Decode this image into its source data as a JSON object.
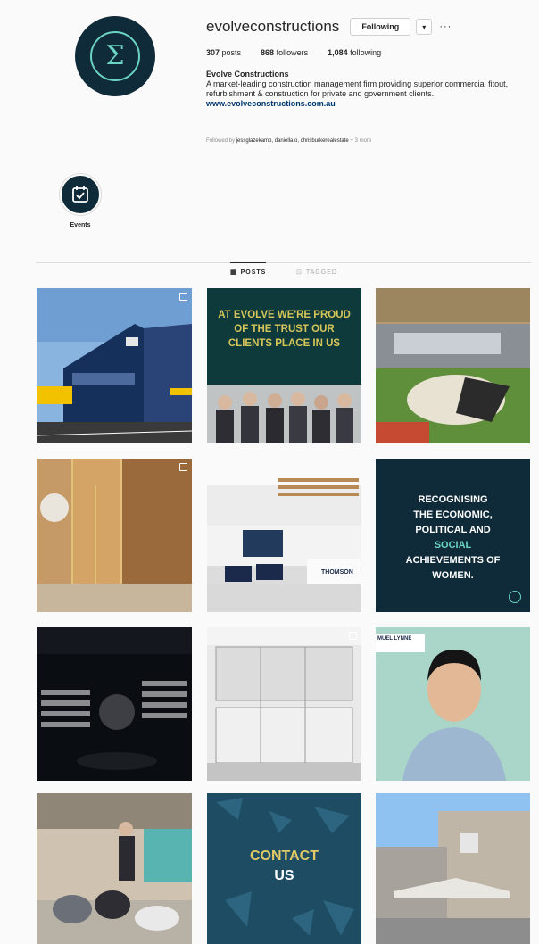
{
  "profile": {
    "username": "evolveconstructions",
    "follow_label": "Following",
    "more_label": "···",
    "posts": "307",
    "posts_label": " posts",
    "followers": "868",
    "followers_label": " followers",
    "following": "1,084",
    "following_label": " following",
    "display_name": "Evolve Constructions",
    "bio": "A market-leading construction management firm providing superior commercial fitout, refurbishment & construction for private and government clients.",
    "website": "www.evolveconstructions.com.au",
    "followed_prefix": "Followed by ",
    "followed_names": "jessglazekamp, daniella.o, chrisburkerealestate",
    "followed_suffix": " + 3 more"
  },
  "highlights": [
    {
      "label": "Events",
      "icon": "calendar-check-icon"
    }
  ],
  "tabs": [
    {
      "label": "POSTS",
      "icon": "grid-icon",
      "active": true
    },
    {
      "label": "TAGGED",
      "icon": "tag-icon",
      "active": false
    }
  ],
  "posts": [
    {
      "id": "post-1",
      "caption": "",
      "multi": true
    },
    {
      "id": "post-2",
      "caption_lines": [
        "AT EVOLVE WE'RE PROUD",
        "OF THE TRUST OUR",
        "CLIENTS PLACE IN US"
      ],
      "multi": false
    },
    {
      "id": "post-3",
      "caption": "",
      "multi": false
    },
    {
      "id": "post-4",
      "caption": "",
      "multi": true
    },
    {
      "id": "post-5",
      "sign": "THOMSON",
      "multi": false
    },
    {
      "id": "post-6",
      "caption_lines": [
        "RECOGNISING",
        "THE ECONOMIC,",
        "POLITICAL AND",
        "SOCIAL",
        "ACHIEVEMENTS OF",
        "WOMEN."
      ],
      "multi": false
    },
    {
      "id": "post-7",
      "caption": "",
      "multi": false
    },
    {
      "id": "post-8",
      "caption": "",
      "multi": true
    },
    {
      "id": "post-9",
      "name_tag": "MUEL LYNNE",
      "multi": false
    },
    {
      "id": "post-10",
      "caption": "",
      "multi": false
    },
    {
      "id": "post-11",
      "caption_lines": [
        "CONTACT",
        "US"
      ],
      "multi": false
    },
    {
      "id": "post-12",
      "caption": "",
      "multi": false
    }
  ],
  "colors": {
    "brand_navy": "#0f2a38",
    "brand_teal": "#6bd3c3",
    "link": "#00376b"
  }
}
